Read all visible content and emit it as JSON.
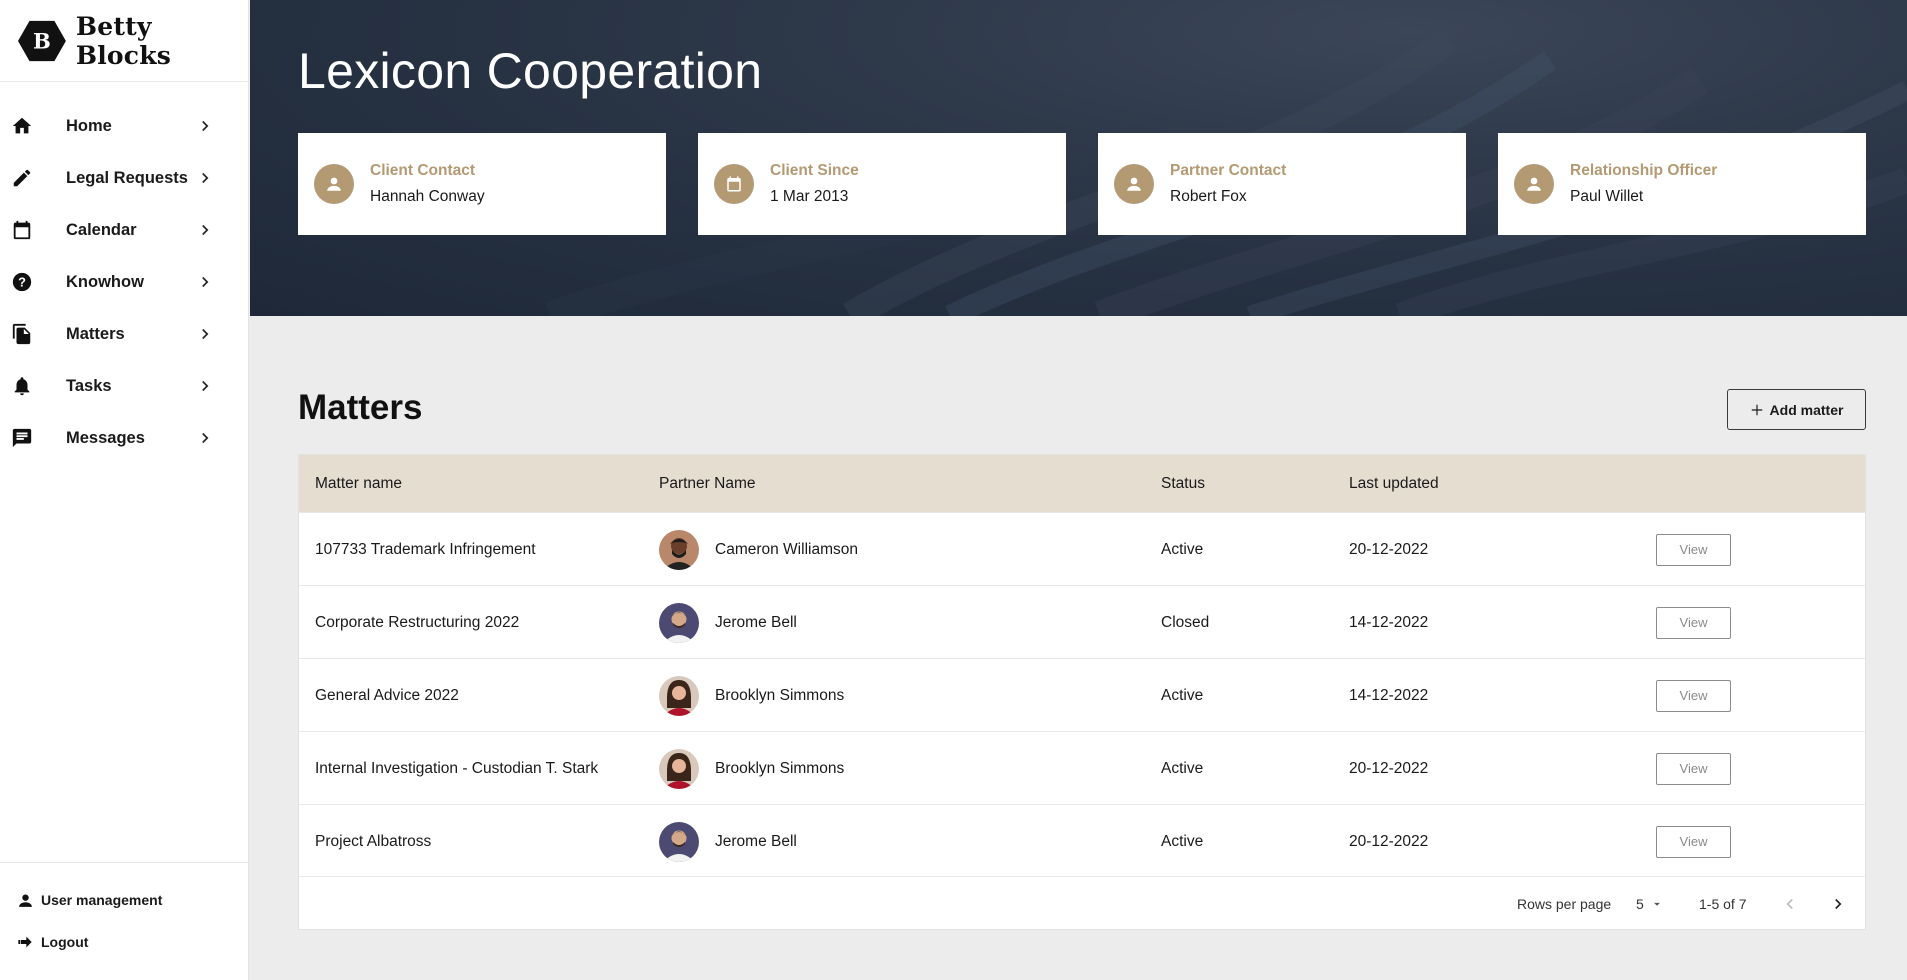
{
  "brand": {
    "name": "Betty Blocks",
    "logo_letter": "B"
  },
  "sidebar": {
    "items": [
      {
        "label": "Home",
        "icon": "home-icon"
      },
      {
        "label": "Legal Requests",
        "icon": "pencil-icon"
      },
      {
        "label": "Calendar",
        "icon": "calendar-icon"
      },
      {
        "label": "Knowhow",
        "icon": "help-circle-icon"
      },
      {
        "label": "Matters",
        "icon": "files-icon"
      },
      {
        "label": "Tasks",
        "icon": "bell-icon"
      },
      {
        "label": "Messages",
        "icon": "message-icon"
      }
    ],
    "footer": [
      {
        "label": "User management",
        "icon": "person-icon"
      },
      {
        "label": "Logout",
        "icon": "logout-arrow-icon"
      }
    ]
  },
  "client": {
    "name": "Lexicon Cooperation",
    "cards": [
      {
        "label": "Client Contact",
        "value": "Hannah Conway",
        "icon": "person-icon"
      },
      {
        "label": "Client Since",
        "value": "1 Mar 2013",
        "icon": "calendar-icon"
      },
      {
        "label": "Partner Contact",
        "value": "Robert Fox",
        "icon": "person-icon"
      },
      {
        "label": "Relationship Officer",
        "value": "Paul Willet",
        "icon": "person-icon"
      }
    ]
  },
  "matters": {
    "title": "Matters",
    "add_label": "Add matter",
    "columns": [
      "Matter name",
      "Partner Name",
      "Status",
      "Last updated"
    ],
    "rows": [
      {
        "name": "107733 Trademark Infringement",
        "partner": "Cameron Williamson",
        "status": "Active",
        "updated": "20-12-2022",
        "view": "View"
      },
      {
        "name": "Corporate Restructuring 2022",
        "partner": "Jerome Bell",
        "status": "Closed",
        "updated": "14-12-2022",
        "view": "View"
      },
      {
        "name": "General Advice 2022",
        "partner": "Brooklyn Simmons",
        "status": "Active",
        "updated": "14-12-2022",
        "view": "View"
      },
      {
        "name": "Internal Investigation - Custodian T. Stark",
        "partner": "Brooklyn Simmons",
        "status": "Active",
        "updated": "20-12-2022",
        "view": "View"
      },
      {
        "name": "Project Albatross",
        "partner": "Jerome Bell",
        "status": "Active",
        "updated": "20-12-2022",
        "view": "View"
      }
    ],
    "pagination": {
      "rows_per_page_label": "Rows per page",
      "rows_per_page": "5",
      "range": "1-5 of 7"
    }
  },
  "colors": {
    "accent": "#b39a73",
    "header_bg": "#e5ddd0",
    "hero_bg": "#263142",
    "page_bg": "#ececec"
  }
}
